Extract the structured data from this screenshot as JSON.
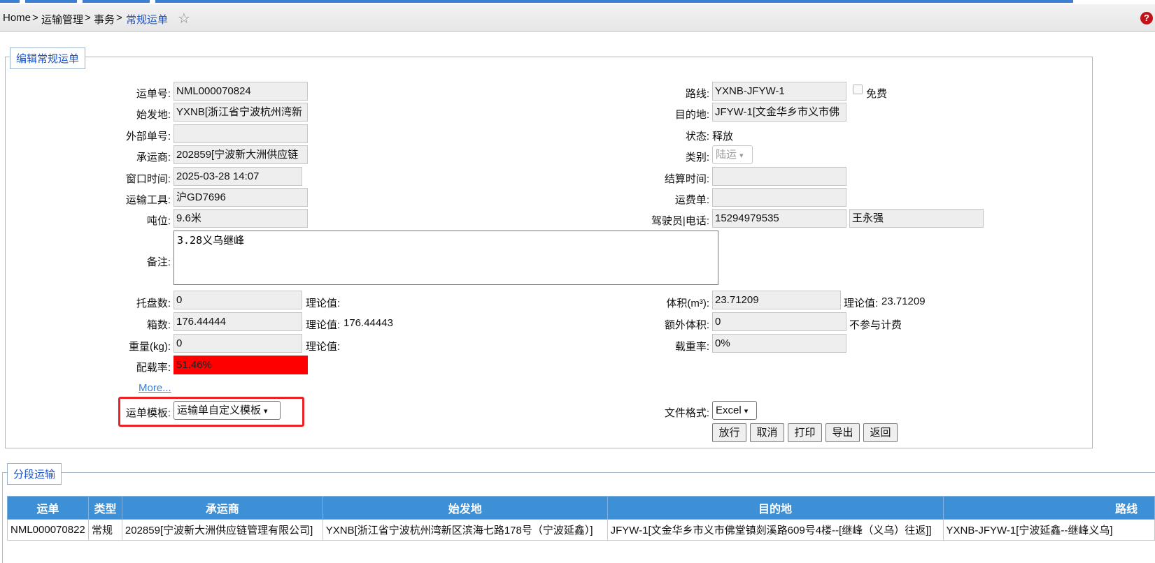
{
  "breadcrumb": [
    "Home",
    ">",
    "运输管理",
    ">",
    "事务",
    ">",
    "常规运单"
  ],
  "form": {
    "legend": "编辑常规运单",
    "waybill_no": {
      "label": "运单号:",
      "value": "NML000070824"
    },
    "route": {
      "label": "路线:",
      "value": "YXNB-JFYW-1"
    },
    "free": {
      "label": "免费",
      "checked": false
    },
    "origin": {
      "label": "始发地:",
      "value": "YXNB[浙江省宁波杭州湾新"
    },
    "destination": {
      "label": "目的地:",
      "value": "JFYW-1[文金华乡市义市佛"
    },
    "external_no": {
      "label": "外部单号:",
      "value": ""
    },
    "status": {
      "label": "状态:",
      "value": "释放"
    },
    "carrier": {
      "label": "承运商:",
      "value": "202859[宁波新大洲供应链"
    },
    "category": {
      "label": "类别:",
      "value": "陆运"
    },
    "window_time": {
      "label": "窗口时间:",
      "value": "2025-03-28 14:07"
    },
    "settle_time": {
      "label": "结算时间:",
      "value": ""
    },
    "vehicle": {
      "label": "运输工具:",
      "value": "沪GD7696"
    },
    "freight_bill": {
      "label": "运费单:",
      "value": ""
    },
    "tonnage": {
      "label": "吨位:",
      "value": "9.6米"
    },
    "driver": {
      "label": "驾驶员|电话:",
      "phone": "15294979535",
      "name": "王永强"
    },
    "remark": {
      "label": "备注:",
      "value": "3.28义乌继峰"
    },
    "pallets": {
      "label": "托盘数:",
      "value": "0",
      "theory_label": "理论值:",
      "theory_value": ""
    },
    "volume": {
      "label": "体积(m³):",
      "value": "23.71209",
      "theory_label": "理论值:",
      "theory_value": "23.71209"
    },
    "boxes": {
      "label": "箱数:",
      "value": "176.44444",
      "theory_label": "理论值:",
      "theory_value": "176.44443"
    },
    "extra_volume": {
      "label": "额外体积:",
      "value": "0",
      "note": "不参与计费"
    },
    "weight": {
      "label": "重量(kg):",
      "value": "0",
      "theory_label": "理论值:",
      "theory_value": ""
    },
    "load_rate": {
      "label": "载重率:",
      "value": "0%"
    },
    "fill_rate": {
      "label": "配载率:",
      "value": "51.46%",
      "color": "#ff0000"
    },
    "more_link": "More...",
    "template": {
      "label": "运单模板:",
      "value": "运输单自定义模板",
      "highlight_color": "#e8232a"
    },
    "file_format": {
      "label": "文件格式:",
      "value": "Excel"
    },
    "buttons": {
      "release": "放行",
      "cancel": "取消",
      "print": "打印",
      "export": "导出",
      "back": "返回"
    }
  },
  "segment": {
    "legend": "分段运输",
    "columns": [
      "运单",
      "类型",
      "承运商",
      "始发地",
      "目的地",
      "路线"
    ],
    "rows": [
      [
        "NML000070822",
        "常规",
        "202859[宁波新大洲供应链管理有限公司]",
        "YXNB[浙江省宁波杭州湾新区滨海七路178号（宁波延鑫）]",
        "JFYW-1[文金华乡市义市佛堂镇剡溪路609号4楼--[继峰（义乌）往返]]",
        "YXNB-JFYW-1[宁波延鑫--继峰义乌]"
      ]
    ]
  },
  "colors": {
    "accent": "#1a55c8",
    "table_header": "#3d8fd6"
  }
}
